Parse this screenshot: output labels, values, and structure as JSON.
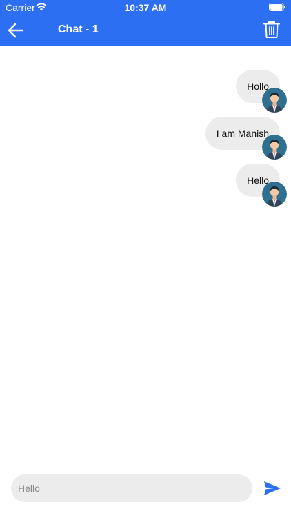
{
  "status_bar": {
    "carrier": "Carrier",
    "time": "10:37 AM",
    "wifi_icon": "wifi-icon",
    "battery_icon": "battery-full-icon"
  },
  "header": {
    "title": "Chat - 1",
    "back_icon": "arrow-left-icon",
    "delete_icon": "trash-icon",
    "background_color": "#2d6ff2"
  },
  "messages": [
    {
      "text": "Hollo",
      "sender": "me",
      "avatar_icon": "user-avatar-icon"
    },
    {
      "text": "I am Manish",
      "sender": "me",
      "avatar_icon": "user-avatar-icon"
    },
    {
      "text": "Hello",
      "sender": "me",
      "avatar_icon": "user-avatar-icon"
    }
  ],
  "composer": {
    "placeholder": "Hello",
    "value": "",
    "send_icon": "send-icon",
    "send_color": "#2d6ff2"
  }
}
